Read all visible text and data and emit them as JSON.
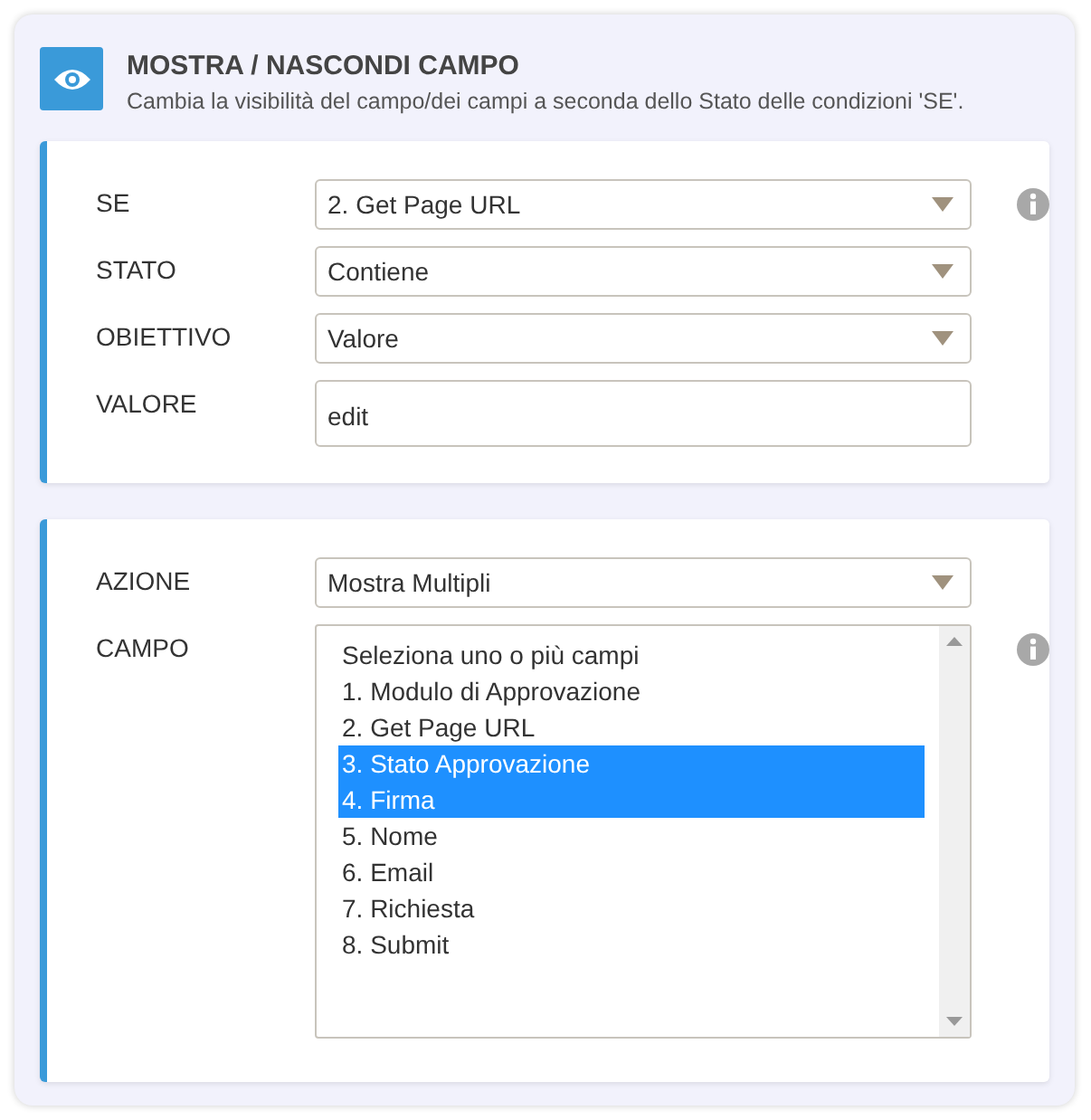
{
  "header": {
    "title": "MOSTRA / NASCONDI CAMPO",
    "subtitle": "Cambia la visibilità del campo/dei campi a seconda dello Stato delle condizioni 'SE'."
  },
  "panels": [
    {
      "rows": [
        {
          "label": "SE",
          "kind": "select",
          "value": "2. Get Page URL",
          "info": true
        },
        {
          "label": "STATO",
          "kind": "select",
          "value": "Contiene",
          "info": false
        },
        {
          "label": "OBIETTIVO",
          "kind": "select",
          "value": "Valore",
          "info": false
        },
        {
          "label": "VALORE",
          "kind": "text",
          "value": "edit",
          "info": false
        }
      ]
    },
    {
      "rows": [
        {
          "label": "AZIONE",
          "kind": "select",
          "value": "Mostra Multipli",
          "info": false
        },
        {
          "label": "CAMPO",
          "kind": "listbox",
          "info": true,
          "options": [
            {
              "label": "Seleziona uno o più campi",
              "selected": false
            },
            {
              "label": "1. Modulo di Approvazione",
              "selected": false
            },
            {
              "label": "2. Get Page URL",
              "selected": false
            },
            {
              "label": "3. Stato Approvazione",
              "selected": true
            },
            {
              "label": "4. Firma",
              "selected": true
            },
            {
              "label": "5. Nome",
              "selected": false
            },
            {
              "label": "6. Email",
              "selected": false
            },
            {
              "label": "7. Richiesta",
              "selected": false
            },
            {
              "label": "8. Submit",
              "selected": false
            }
          ]
        }
      ]
    }
  ]
}
